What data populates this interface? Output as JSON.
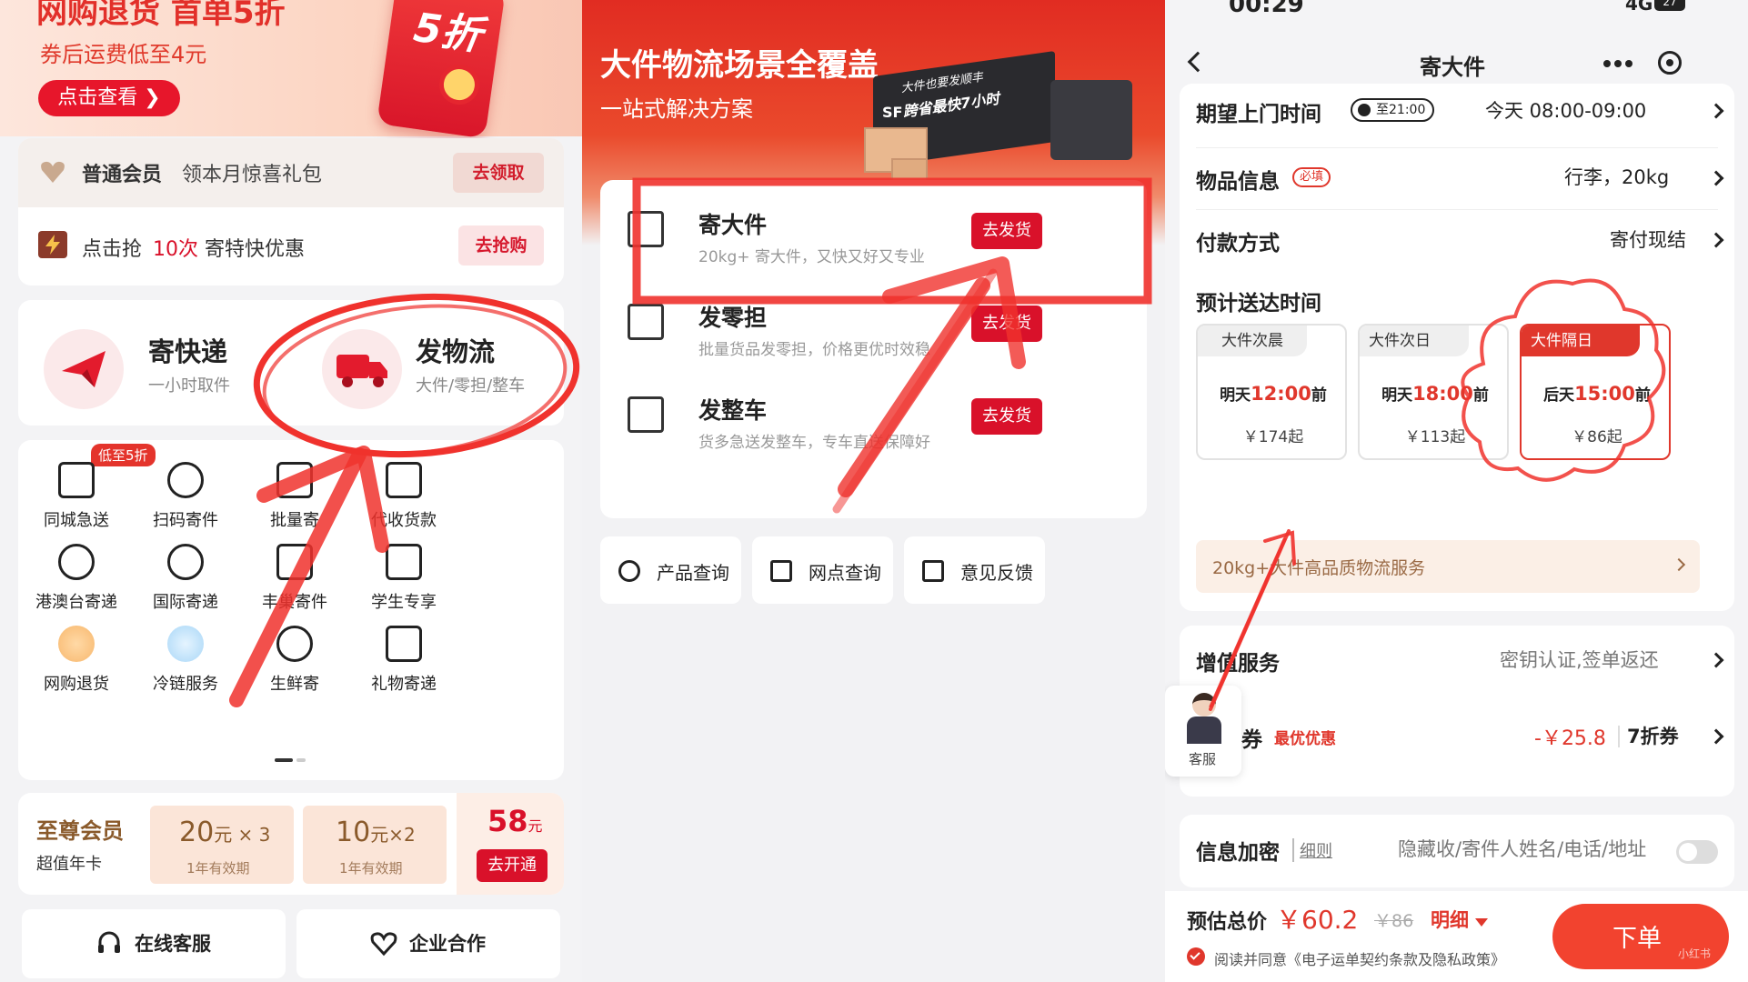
{
  "left": {
    "banner": {
      "title": "网购退货 首单5折",
      "subtitle": "券后运费低至4元",
      "cta": "点击查看 ❯",
      "badge": "5折"
    },
    "member_row": {
      "level": "普通会员",
      "text": "领本月惊喜礼包",
      "btn": "去领取"
    },
    "promo_row": {
      "prefix": "点击抢",
      "count": "10次",
      "suffix": "寄特快优惠",
      "btn": "去抢购"
    },
    "send_express": {
      "title": "寄快递",
      "sub": "一小时取件"
    },
    "send_logistics": {
      "title": "发物流",
      "sub": "大件/零担/整车"
    },
    "grid_badge": "低至5折",
    "grid": [
      {
        "label": "同城急送",
        "icon": "cube-icon"
      },
      {
        "label": "扫码寄件",
        "icon": "scan-icon"
      },
      {
        "label": "批量寄",
        "icon": "batch-icon"
      },
      {
        "label": "代收货款",
        "icon": "payment-icon"
      },
      {
        "label": "港澳台寄递",
        "icon": "globe-hk-icon"
      },
      {
        "label": "国际寄递",
        "icon": "globe-icon"
      },
      {
        "label": "丰巢寄件",
        "icon": "locker-24h-icon"
      },
      {
        "label": "学生专享",
        "icon": "graduation-icon"
      },
      {
        "label": "网购退货",
        "icon": "shopping-cart-icon"
      },
      {
        "label": "冷链服务",
        "icon": "snowflake-icon"
      },
      {
        "label": "生鲜寄",
        "icon": "cherry-icon"
      },
      {
        "label": "礼物寄递",
        "icon": "gift-icon"
      }
    ],
    "vip": {
      "title": "至尊会员",
      "sub": "超值年卡",
      "c1_amt": "20",
      "c1_unit": "元 × 3",
      "c1_sub": "1年有效期",
      "c2_amt": "10",
      "c2_unit": "元×2",
      "c2_sub": "1年有效期",
      "price": "58",
      "price_unit": "元",
      "btn": "去开通"
    },
    "footer": {
      "service": "在线客服",
      "partner": "企业合作"
    }
  },
  "middle": {
    "banner_title": "大件物流场景全覆盖",
    "banner_sub": "一站式解决方案",
    "truck_text_1": "大件也要发顺丰",
    "truck_text_2": "跨省最快7小时",
    "truck_logo": "SF",
    "services": [
      {
        "title": "寄大件",
        "sub": "20kg+ 寄大件，又快又好又专业",
        "btn": "去发货",
        "icon": "package-20kg-icon"
      },
      {
        "title": "发零担",
        "sub": "批量货品发零担，价格更优时效稳",
        "btn": "去发货",
        "icon": "pallet-icon"
      },
      {
        "title": "发整车",
        "sub": "货多急送发整车，专车直送保障好",
        "btn": "去发货",
        "icon": "truck-icon"
      }
    ],
    "bottom": [
      {
        "label": "产品查询",
        "icon": "search-icon"
      },
      {
        "label": "网点查询",
        "icon": "store-icon"
      },
      {
        "label": "意见反馈",
        "icon": "feedback-icon"
      }
    ]
  },
  "right": {
    "status": {
      "time": "00:29",
      "net": "4G",
      "battery": "27"
    },
    "nav_title": "寄大件",
    "pickup": {
      "label": "期望上门时间",
      "tag": "至21:00",
      "value": "今天 08:00-09:00"
    },
    "item": {
      "label": "物品信息",
      "tag": "必填",
      "value": "行李，20kg"
    },
    "payment": {
      "label": "付款方式",
      "value": "寄付现结"
    },
    "delivery_title": "预计送达时间",
    "options": [
      {
        "name": "大件次晨",
        "day": "明天",
        "time": "12:00",
        "suffix": "前",
        "price": "￥174起"
      },
      {
        "name": "大件次日",
        "day": "明天",
        "time": "18:00",
        "suffix": "前",
        "price": "￥113起"
      },
      {
        "name": "大件隔日",
        "day": "后天",
        "time": "15:00",
        "suffix": "前",
        "price": "￥86起"
      }
    ],
    "service_banner": "20kg+大件高品质物流服务",
    "value_added": {
      "label": "增值服务",
      "value": "密钥认证,签单返还"
    },
    "coupon": {
      "label": "券",
      "tag": "最优优惠",
      "discount": "-￥25.8",
      "value": "7折券"
    },
    "service_avatar_label": "客服",
    "privacy": {
      "label": "信息加密",
      "link": "细则",
      "value": "隐藏收/寄件人姓名/电话/地址"
    },
    "total": {
      "label": "预估总价",
      "price": "￥60.2",
      "old": "￥86",
      "detail": "明细"
    },
    "agree": "阅读并同意《电子运单契约条款及隐私政策》",
    "order_btn": "下单",
    "watermark": "小红书"
  },
  "colors": {
    "brand_red": "#d9112a",
    "annotation_red": "#f0322d",
    "gold": "#8a5a2b"
  }
}
